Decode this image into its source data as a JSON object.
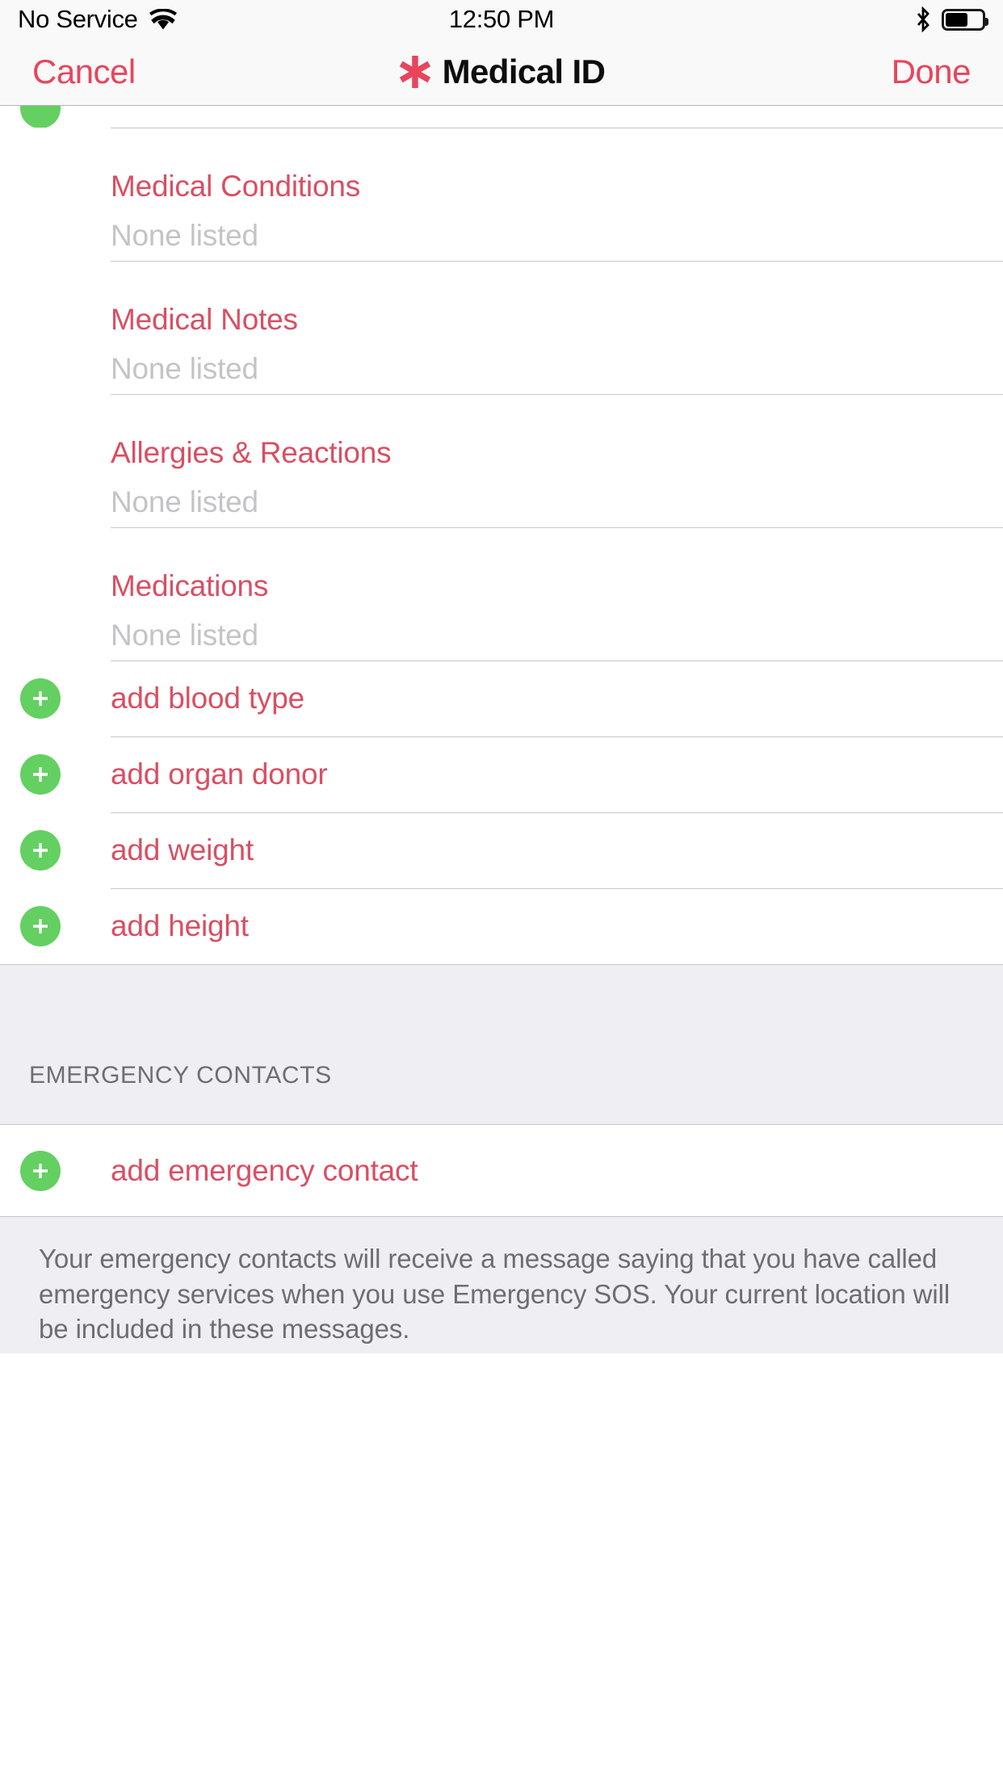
{
  "status_bar": {
    "carrier": "No Service",
    "wifi_icon": "wifi-icon",
    "time": "12:50 PM",
    "bluetooth_icon": "bluetooth-icon",
    "battery_icon": "battery-icon",
    "battery_level_percent": 55
  },
  "nav_bar": {
    "cancel_label": "Cancel",
    "title": "Medical ID",
    "title_icon": "medical-asterisk-icon",
    "done_label": "Done",
    "accent_color": "#e8455c"
  },
  "colors": {
    "accent_red": "#d94f63",
    "nav_red": "#e8455c",
    "add_green": "#63d061",
    "placeholder_gray": "#c4c4c6",
    "group_background": "#eeeef3",
    "separator": "#c8c7cc",
    "section_header_text": "#6d6d72"
  },
  "medical_fields": [
    {
      "label": "Medical Conditions",
      "value": "None listed"
    },
    {
      "label": "Medical Notes",
      "value": "None listed"
    },
    {
      "label": "Allergies & Reactions",
      "value": "None listed"
    },
    {
      "label": "Medications",
      "value": "None listed"
    }
  ],
  "add_rows": [
    {
      "label": "add blood type",
      "icon": "plus-icon"
    },
    {
      "label": "add organ donor",
      "icon": "plus-icon"
    },
    {
      "label": "add weight",
      "icon": "plus-icon"
    },
    {
      "label": "add height",
      "icon": "plus-icon"
    }
  ],
  "emergency_contacts": {
    "section_header": "EMERGENCY CONTACTS",
    "add_label": "add emergency contact",
    "add_icon": "plus-icon",
    "footer": "Your emergency contacts will receive a message saying that you have called emergency services when you use Emergency SOS. Your current location will be included in these messages."
  }
}
